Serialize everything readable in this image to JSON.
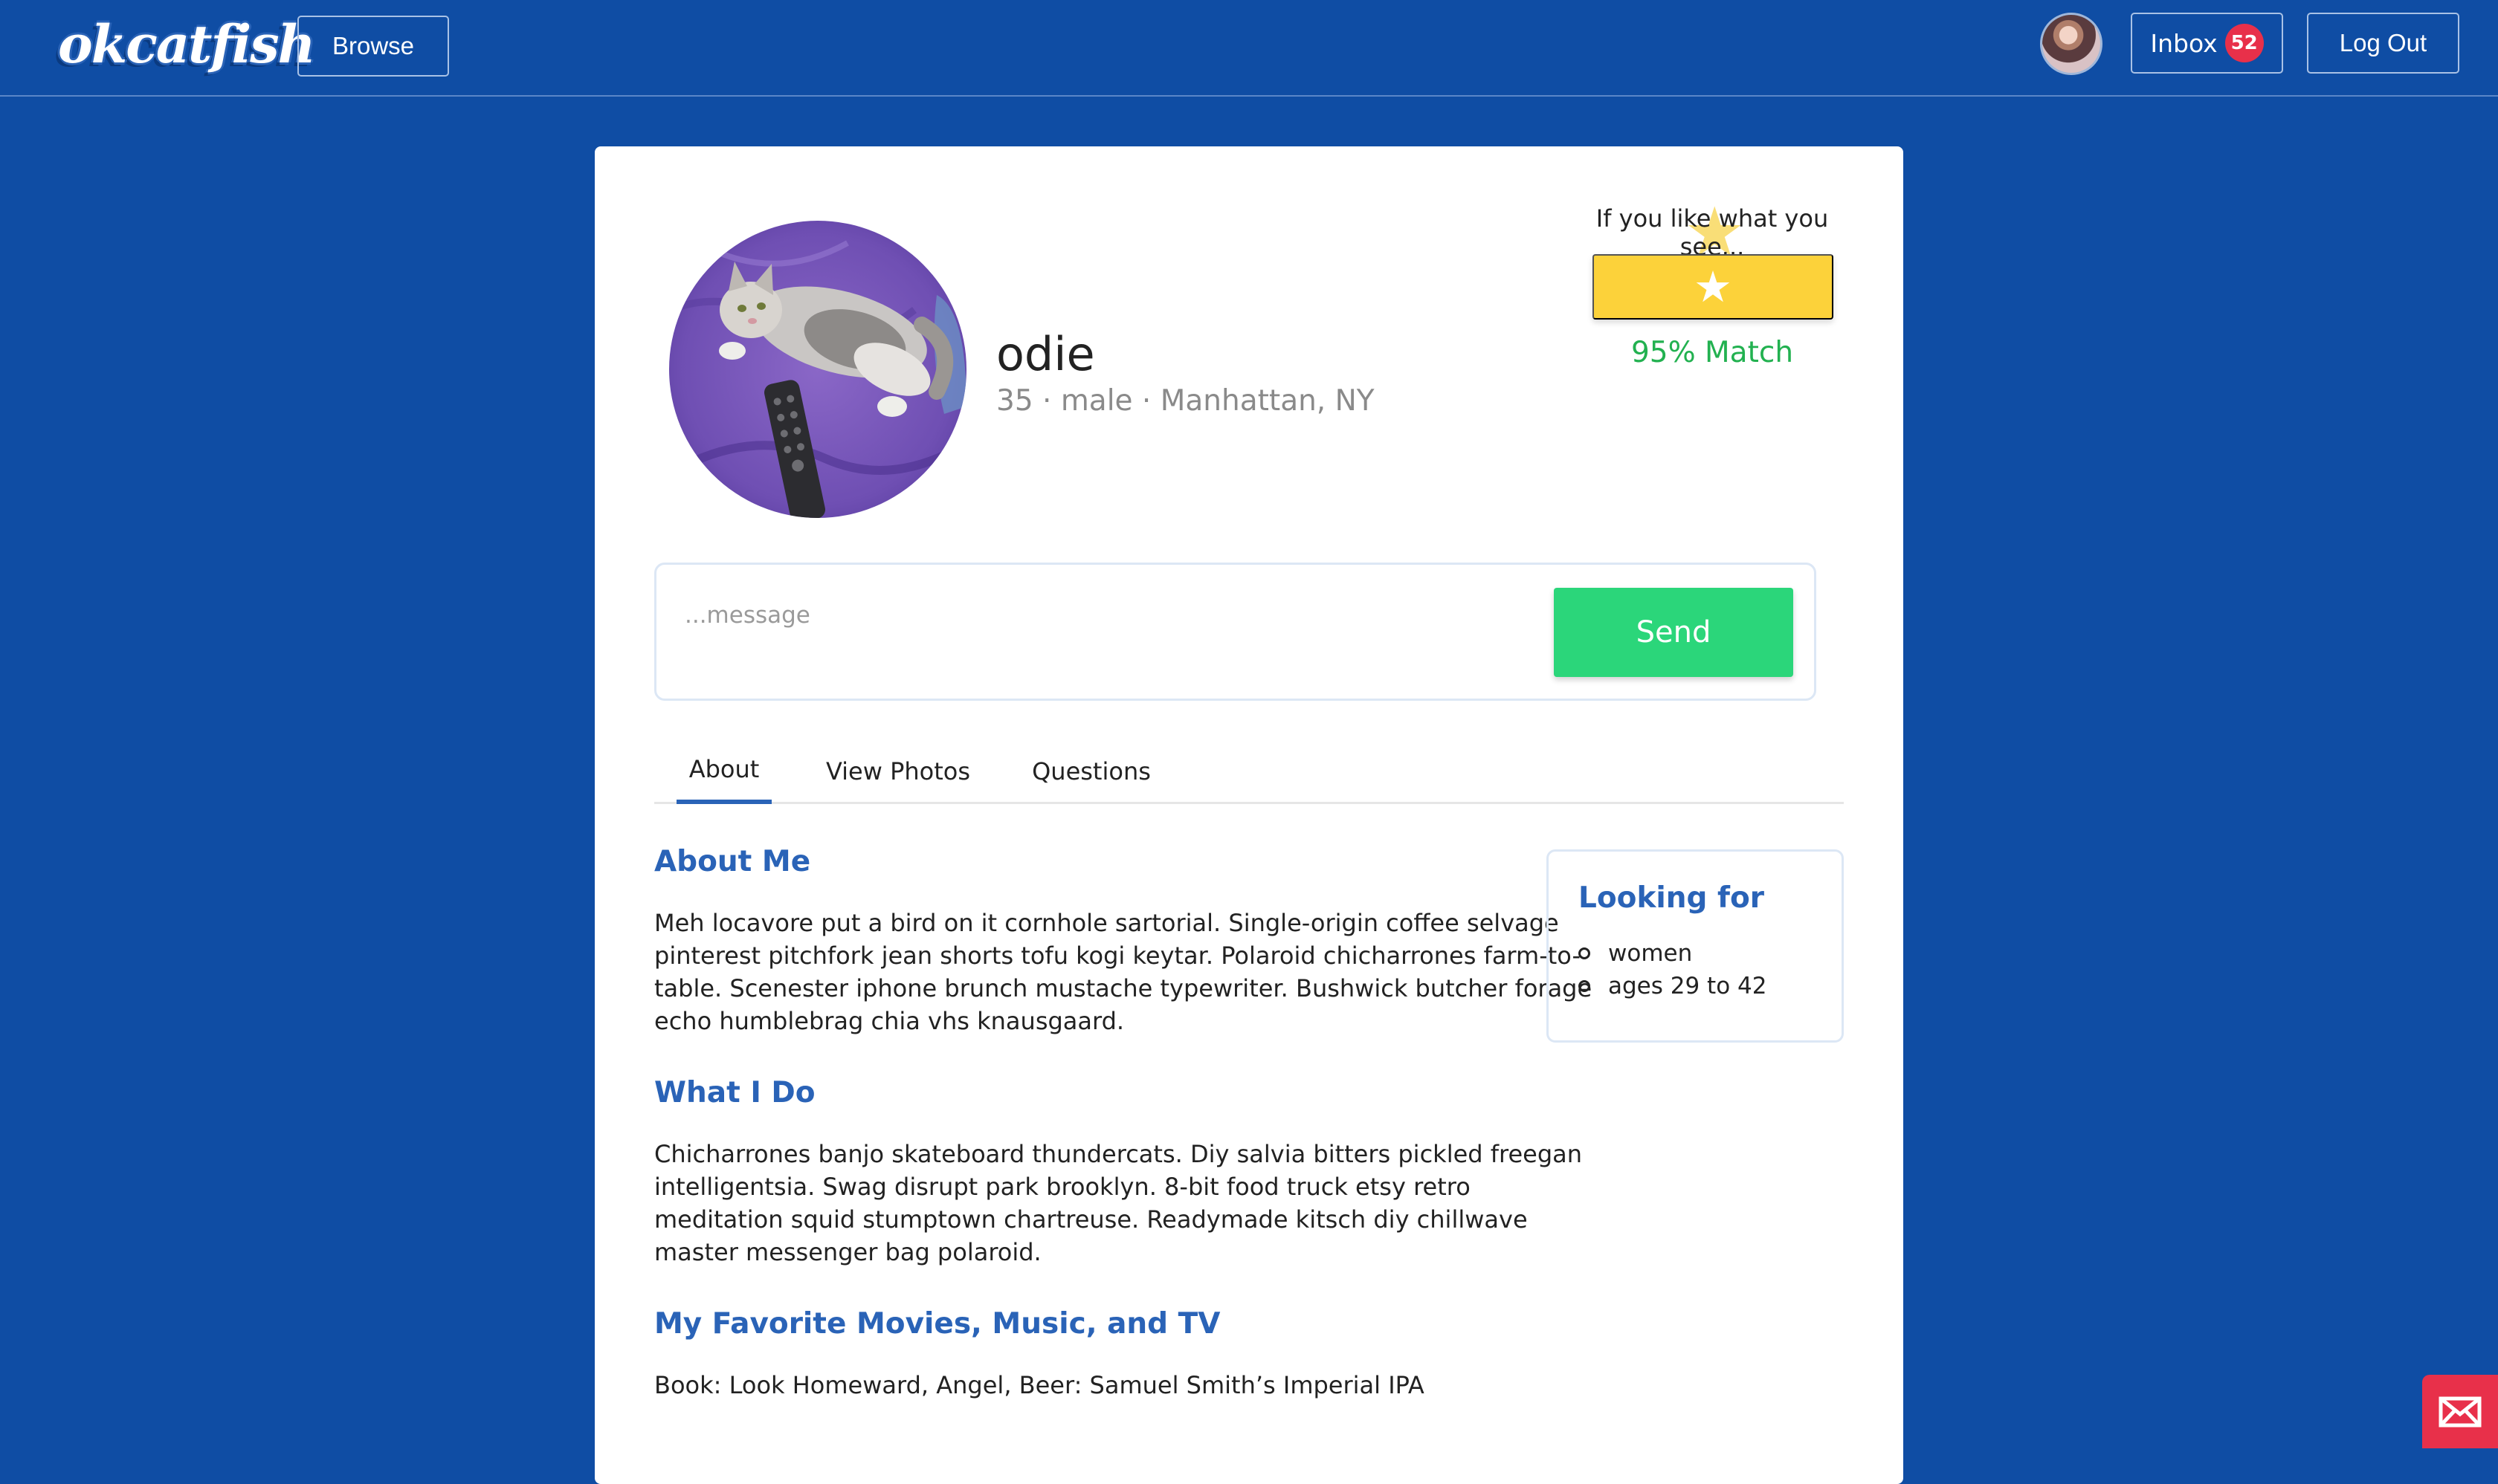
{
  "nav": {
    "logo": "okcatfish",
    "browse_label": "Browse",
    "inbox_label": "Inbox",
    "inbox_count": "52",
    "logout_label": "Log Out"
  },
  "profile": {
    "name": "odie",
    "meta": "35 · male · Manhattan, NY",
    "like_prompt": "If you like what you see...",
    "like_icon": "★",
    "match": "95% Match"
  },
  "message": {
    "placeholder": "...message",
    "value": "",
    "send_label": "Send"
  },
  "tabs": [
    {
      "label": "About",
      "active": true
    },
    {
      "label": "View Photos",
      "active": false
    },
    {
      "label": "Questions",
      "active": false
    }
  ],
  "sections": [
    {
      "heading": "About Me",
      "body": "Meh locavore put a bird on it cornhole sartorial. Single-origin coffee selvage pinterest pitchfork jean shorts tofu kogi keytar. Polaroid chicharrones farm-to-table. Scenester iphone brunch mustache typewriter. Bushwick butcher forage echo humblebrag chia vhs knausgaard."
    },
    {
      "heading": "What I Do",
      "body": "Chicharrones banjo skateboard thundercats. Diy salvia bitters pickled freegan intelligentsia. Swag disrupt park brooklyn. 8-bit food truck etsy retro meditation squid stumptown chartreuse. Readymade kitsch diy chillwave master messenger bag polaroid."
    },
    {
      "heading": "My Favorite Movies, Music, and TV",
      "body": "Book: Look Homeward, Angel, Beer: Samuel Smith’s Imperial IPA"
    }
  ],
  "looking_for": {
    "heading": "Looking for",
    "items": [
      "women",
      "ages 29 to 42"
    ]
  },
  "colors": {
    "background": "#0f4da4",
    "accent": "#2a63b7",
    "like": "#fcd23a",
    "match": "#22b150",
    "send": "#2bd67a",
    "badge": "#e8304a"
  },
  "icons": {
    "nav_avatar": "user-avatar",
    "profile_photo": "cat-photo",
    "like": "star-icon",
    "mail_fab": "envelope-icon"
  }
}
